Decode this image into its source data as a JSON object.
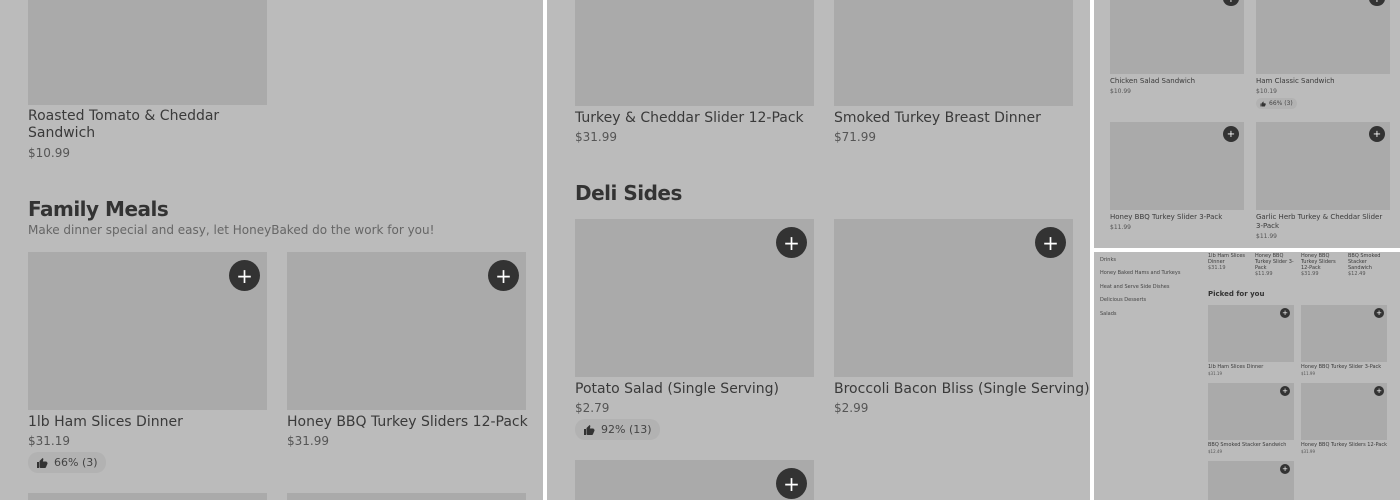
{
  "icons": {
    "add": "plus-icon",
    "rating": "thumbs-up-icon"
  },
  "panel1": {
    "item_top": {
      "name": "Roasted Tomato & Cheddar Sandwich",
      "name_line1": "Roasted Tomato & Cheddar",
      "name_line2": "Sandwich",
      "price": "$10.99"
    },
    "section": {
      "title": "Family Meals",
      "subtitle": "Make dinner special and easy, let HoneyBaked do the work for you!"
    },
    "items": [
      {
        "name": "1lb Ham Slices Dinner",
        "price": "$31.19",
        "rating": "66% (3)"
      },
      {
        "name": "Honey BBQ Turkey Sliders 12-Pack",
        "price": "$31.99"
      }
    ]
  },
  "panel2": {
    "items_top": [
      {
        "name": "Turkey & Cheddar Slider 12-Pack",
        "price": "$31.99"
      },
      {
        "name": "Smoked Turkey Breast Dinner",
        "price": "$71.99"
      }
    ],
    "section": {
      "title": "Deli Sides"
    },
    "items": [
      {
        "name": "Potato Salad (Single Serving)",
        "price": "$2.79",
        "rating": "92% (13)"
      },
      {
        "name": "Broccoli Bacon Bliss (Single Serving)",
        "price": "$2.99"
      }
    ]
  },
  "panel3": {
    "items": [
      {
        "name": "Chicken Salad Sandwich",
        "price": "$10.99"
      },
      {
        "name": "Ham Classic Sandwich",
        "price": "$10.19",
        "rating": "66% (3)"
      },
      {
        "name": "Honey BBQ Turkey Slider 3-Pack",
        "price": "$11.99"
      },
      {
        "name": "Garlic Herb Turkey & Cheddar Slider 3-Pack",
        "name_line1": "Garlic Herb Turkey & Cheddar Slider",
        "name_line2": "3-Pack",
        "price": "$11.99"
      }
    ]
  },
  "panel4": {
    "sidebar": [
      "Drinks",
      "Honey Baked Hams and Turkeys",
      "Heat and Serve Side Dishes",
      "Delicious Desserts",
      "Salads"
    ],
    "top_row": [
      {
        "name": "1lb Ham Slices Dinner",
        "name_line1": "1lb Ham Slices",
        "name_line2": "Dinner",
        "price": "$31.19"
      },
      {
        "name": "Honey BBQ Turkey Slider 3-Pack",
        "name_line1": "Honey BBQ",
        "name_line2": "Turkey Slider 3-",
        "name_line3": "Pack",
        "price": "$11.99"
      },
      {
        "name": "Honey BBQ Turkey Sliders 12-Pack",
        "name_line1": "Honey BBQ",
        "name_line2": "Turkey Sliders",
        "name_line3": "12-Pack",
        "price": "$31.99"
      },
      {
        "name": "BBQ Smoked Stacker Sandwich",
        "name_line1": "BBQ Smoked",
        "name_line2": "Stacker",
        "name_line3": "Sandwich",
        "price": "$12.49"
      }
    ],
    "section": {
      "title": "Picked for you"
    },
    "items": [
      {
        "name": "1lb Ham Slices Dinner",
        "price": "$31.19"
      },
      {
        "name": "Honey BBQ Turkey Slider 3-Pack",
        "price": "$11.99"
      },
      {
        "name": "BBQ Smoked Stacker Sandwich",
        "price": "$12.49"
      },
      {
        "name": "Honey BBQ Turkey Sliders 12-Pack",
        "price": "$31.99"
      }
    ]
  }
}
